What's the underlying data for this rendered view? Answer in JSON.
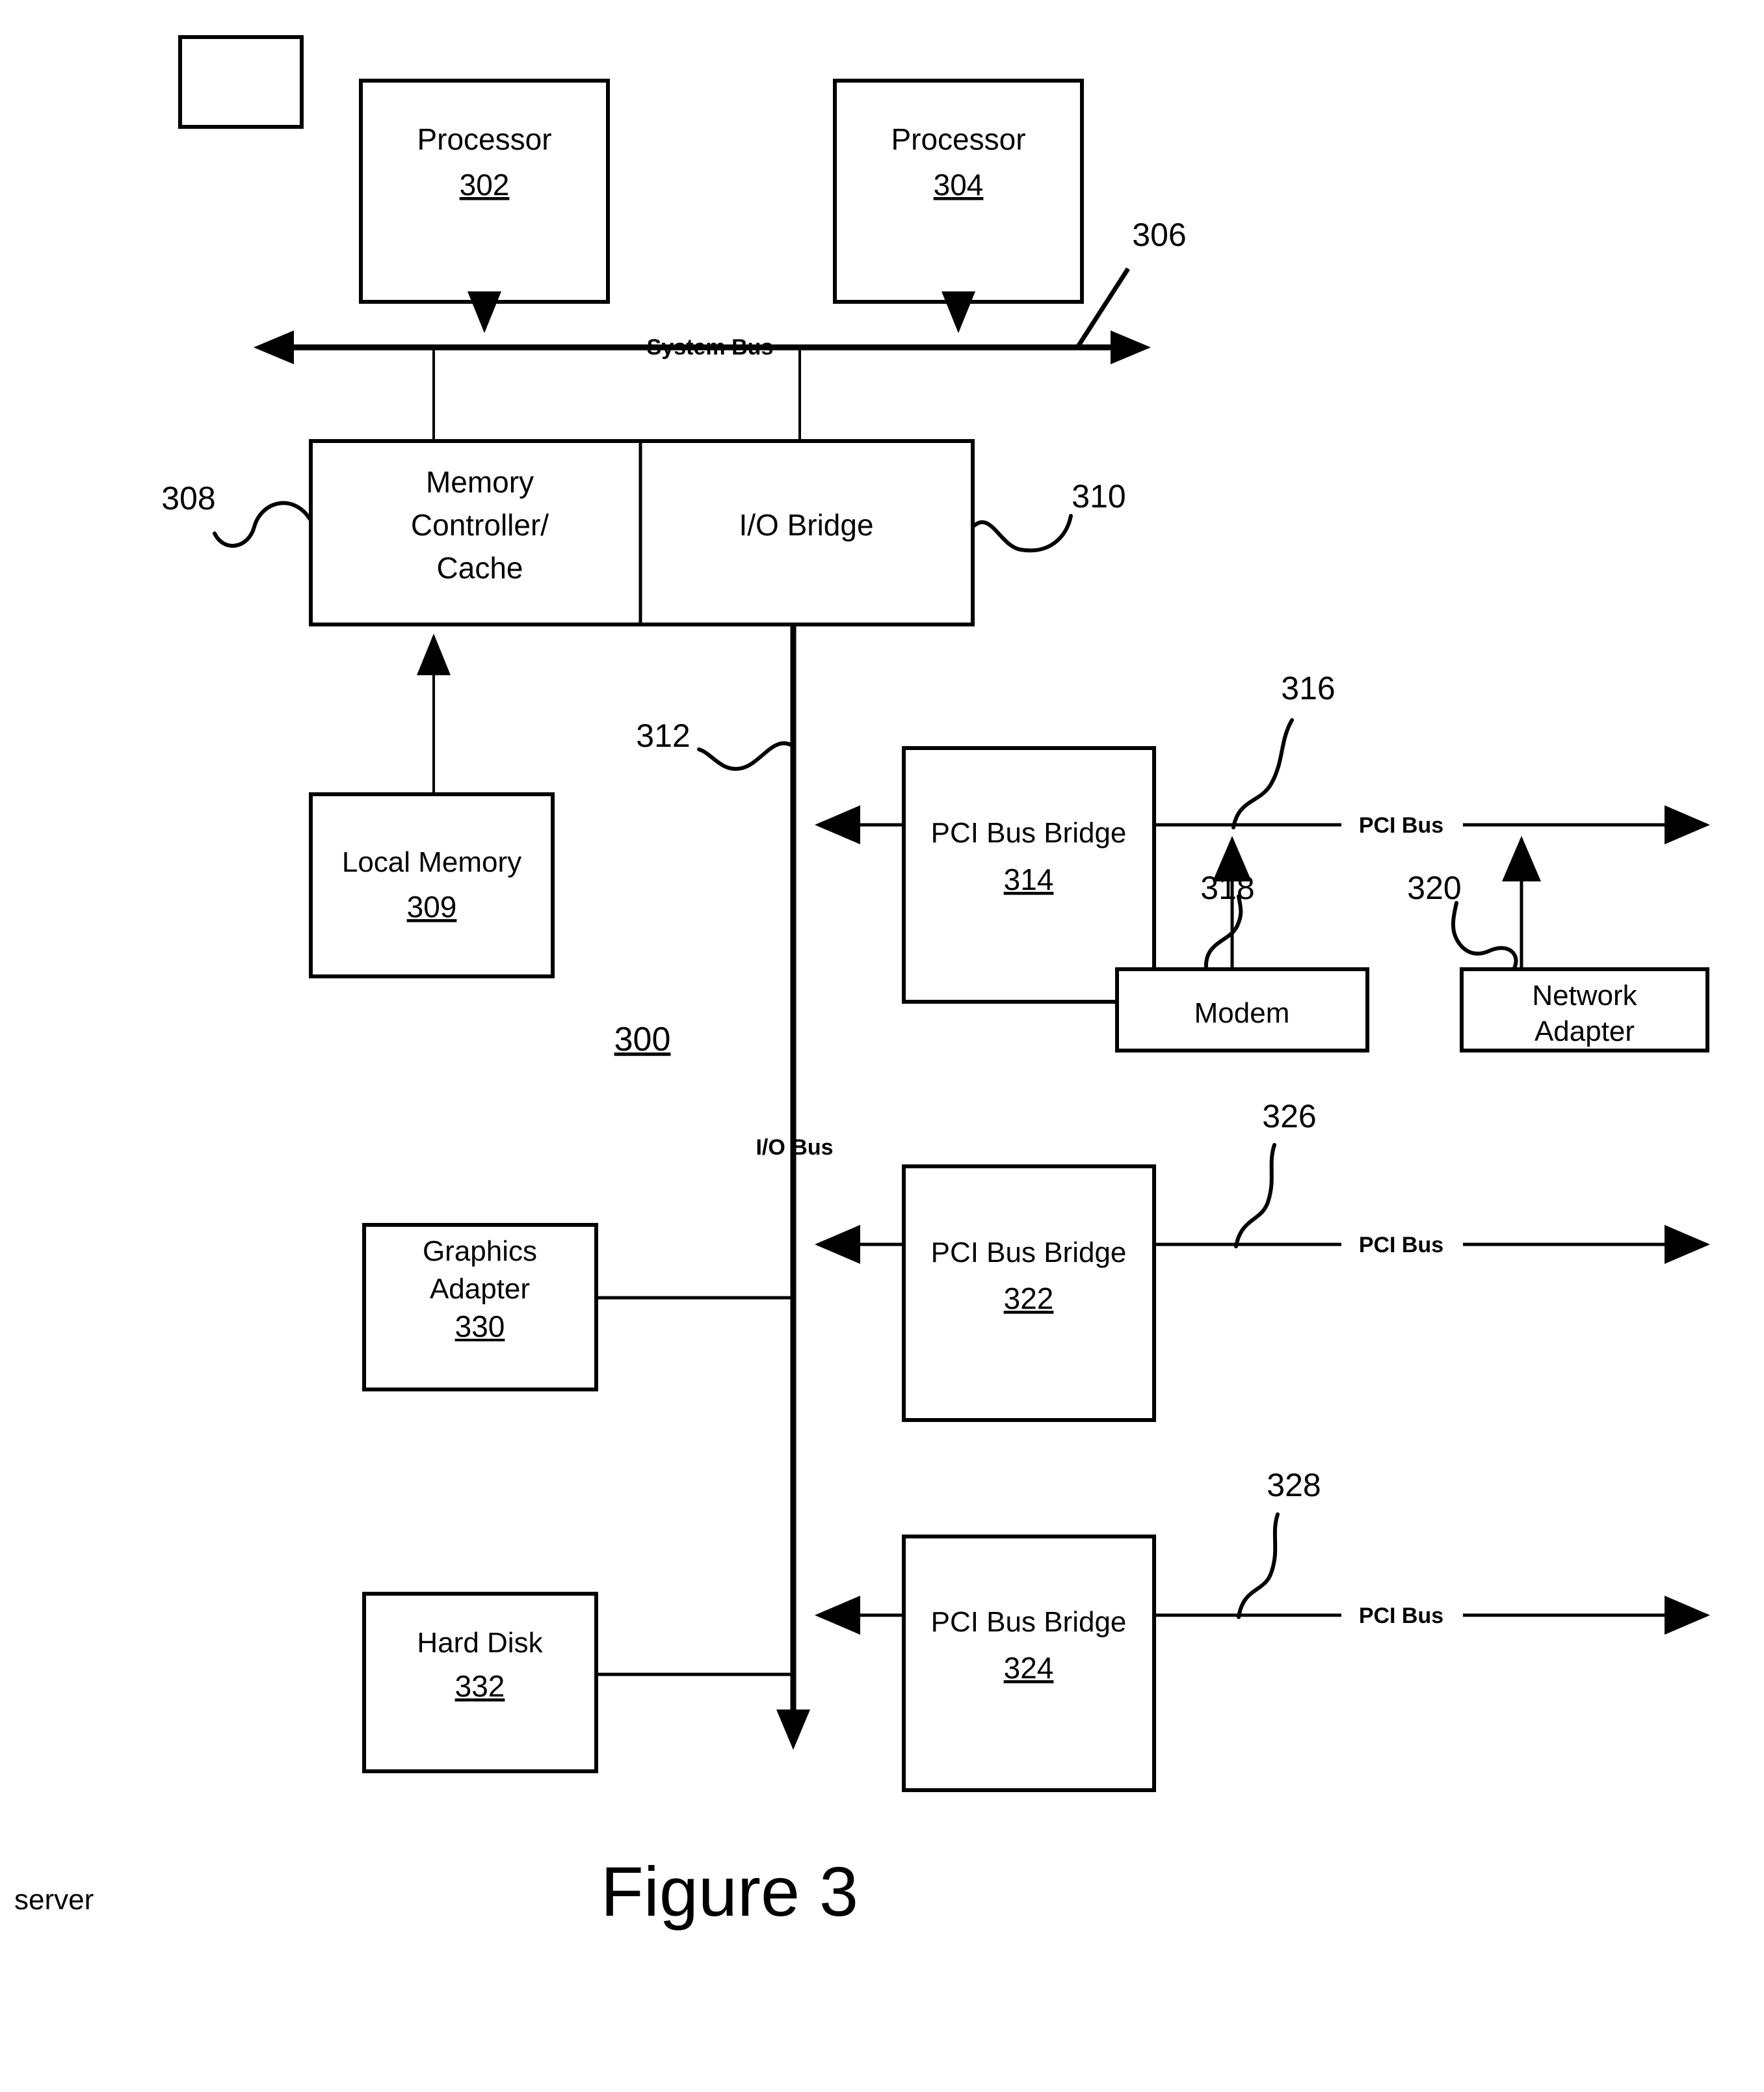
{
  "figure": {
    "caption": "Figure 3",
    "annotation": "server",
    "system_ref": "300"
  },
  "blocks": [
    {
      "id": "processor-302",
      "title": "Processor",
      "number": "302"
    },
    {
      "id": "processor-304",
      "title": "Processor",
      "number": "304"
    },
    {
      "id": "memory-controller-cache",
      "title_line1": "Memory",
      "title_line2": "Controller/",
      "title_line3": "Cache"
    },
    {
      "id": "io-bridge",
      "title": "I/O Bridge"
    },
    {
      "id": "local-memory-309",
      "title": "Local Memory",
      "number": "309"
    },
    {
      "id": "pci-bus-bridge-314",
      "title": "PCI Bus Bridge",
      "number": "314"
    },
    {
      "id": "modem-318",
      "title": "Modem"
    },
    {
      "id": "network-adapter-320",
      "title_line1": "Network",
      "title_line2": "Adapter"
    },
    {
      "id": "pci-bus-bridge-322",
      "title": "PCI Bus Bridge",
      "number": "322"
    },
    {
      "id": "graphics-adapter-330",
      "title_line1": "Graphics",
      "title_line2": "Adapter",
      "number": "330"
    },
    {
      "id": "pci-bus-bridge-324",
      "title": "PCI Bus Bridge",
      "number": "324"
    },
    {
      "id": "hard-disk-332",
      "title": "Hard Disk",
      "number": "332"
    }
  ],
  "bus_labels": {
    "system_bus": "System Bus",
    "io_bus": "I/O Bus",
    "pci_bus_1": "PCI Bus",
    "pci_bus_2": "PCI Bus",
    "pci_bus_3": "PCI Bus"
  },
  "reference_numerals": {
    "system_bus": "306",
    "memory_controller": "308",
    "io_bridge": "310",
    "io_bus": "312",
    "pci_bus_1": "316",
    "modem": "318",
    "network_adapter": "320",
    "pci_bus_2": "326",
    "pci_bus_3": "328"
  },
  "colors": {
    "ink": "#000000",
    "paper": "#ffffff"
  }
}
